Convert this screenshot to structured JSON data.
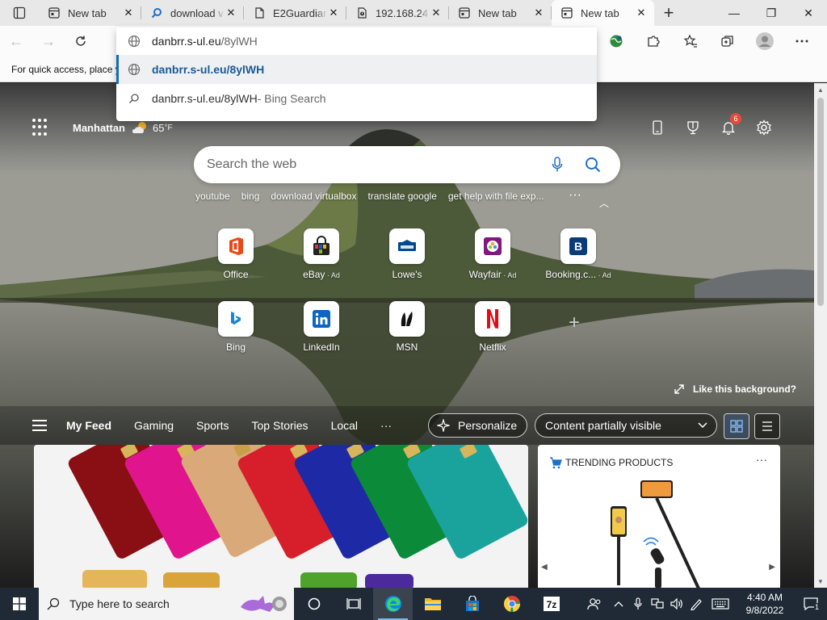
{
  "browser": {
    "tabs": [
      {
        "title": "New tab",
        "icon": "new-tab-icon"
      },
      {
        "title": "download v",
        "icon": "search-icon"
      },
      {
        "title": "E2Guardian",
        "icon": "document-icon"
      },
      {
        "title": "192.168.24",
        "icon": "warning-page-icon"
      },
      {
        "title": "New tab",
        "icon": "new-tab-icon"
      },
      {
        "title": "New tab",
        "icon": "new-tab-icon",
        "active": true
      }
    ],
    "window_controls": {
      "minimize": "—",
      "restore": "❐",
      "close": "✕"
    },
    "favorites_bar_text": "For quick access, place y",
    "omnibox": {
      "typed": "danbrr.s-ul.eu",
      "autocomplete": "/8ylWH",
      "suggestions": [
        {
          "url": "danbrr.s-ul.eu/8ylWH",
          "suffix": "",
          "icon": "globe-icon",
          "selected": true
        },
        {
          "url": "danbrr.s-ul.eu/8ylWH",
          "suffix": " - Bing Search",
          "icon": "search-icon",
          "selected": false
        }
      ]
    }
  },
  "newtab": {
    "location": "Manhattan",
    "temperature": "65",
    "temp_unit": "°F",
    "notification_count": "6",
    "search_placeholder": "Search the web",
    "quick_searches": [
      "youtube",
      "bing",
      "download virtualbox",
      "translate google",
      "get help with file exp..."
    ],
    "tiles": [
      {
        "label": "Office",
        "ad": "",
        "icon": "office-icon"
      },
      {
        "label": "eBay",
        "ad": " · Ad",
        "icon": "ebay-icon"
      },
      {
        "label": "Lowe's",
        "ad": "",
        "icon": "lowes-icon"
      },
      {
        "label": "Wayfair",
        "ad": " · Ad",
        "icon": "wayfair-icon"
      },
      {
        "label": "Booking.c...",
        "ad": " · Ad",
        "icon": "booking-icon"
      },
      {
        "label": "Bing",
        "ad": "",
        "icon": "bing-icon"
      },
      {
        "label": "LinkedIn",
        "ad": "",
        "icon": "linkedin-icon"
      },
      {
        "label": "MSN",
        "ad": "",
        "icon": "msn-icon"
      },
      {
        "label": "Netflix",
        "ad": "",
        "icon": "netflix-icon"
      }
    ],
    "like_background": "Like this background?",
    "feed_nav": [
      "My Feed",
      "Gaming",
      "Sports",
      "Top Stories",
      "Local"
    ],
    "personalize": "Personalize",
    "visibility": "Content partially visible",
    "trending_title": "TRENDING PRODUCTS"
  },
  "taskbar": {
    "search_placeholder": "Type here to search",
    "time": "4:40 AM",
    "date": "9/8/2022",
    "notification_count": "1"
  },
  "colors": {
    "accent": "#0f6cbd",
    "taskbar": "#1f2a36",
    "tab_bar": "#e8e8e8"
  }
}
